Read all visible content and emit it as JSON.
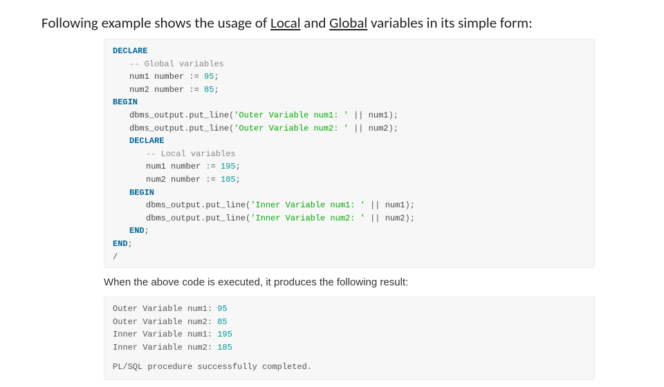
{
  "title_pre": "Following example shows the usage of ",
  "title_local": "Local",
  "title_and": " and ",
  "title_global": "Global",
  "title_post": " variables in its simple form:",
  "code": {
    "l01_declare": "DECLARE",
    "l02a": "-- ",
    "l02b": "Global",
    "l02c": " variables",
    "l03a": "num1 number ",
    "l03b": ":=",
    "l03c": " ",
    "l03d": "95",
    "l03e": ";",
    "l04a": "num2 number ",
    "l04b": ":=",
    "l04c": " ",
    "l04d": "85",
    "l04e": ";",
    "l05_begin": "BEGIN",
    "l06a": "dbms_output",
    "l06b": ".",
    "l06c": "put_line",
    "l06d": "(",
    "l06e": "'Outer Variable num1: '",
    "l06f": " || ",
    "l06g": "num1",
    "l06h": ");",
    "l07a": "dbms_output",
    "l07b": ".",
    "l07c": "put_line",
    "l07d": "(",
    "l07e": "'Outer Variable num2: '",
    "l07f": " || ",
    "l07g": "num2",
    "l07h": ");",
    "l08_declare": "DECLARE",
    "l09a": "-- ",
    "l09b": "Local",
    "l09c": " variables",
    "l10a": "num1 number ",
    "l10b": ":=",
    "l10c": " ",
    "l10d": "195",
    "l10e": ";",
    "l11a": "num2 number ",
    "l11b": ":=",
    "l11c": " ",
    "l11d": "185",
    "l11e": ";",
    "l12_begin": "BEGIN",
    "l13a": "dbms_output",
    "l13b": ".",
    "l13c": "put_line",
    "l13d": "(",
    "l13e": "'Inner Variable num1: '",
    "l13f": " || ",
    "l13g": "num1",
    "l13h": ");",
    "l14a": "dbms_output",
    "l14b": ".",
    "l14c": "put_line",
    "l14d": "(",
    "l14e": "'Inner Variable num2: '",
    "l14f": " || ",
    "l14g": "num2",
    "l14h": ");",
    "l15_end": "END",
    "l15_s": ";",
    "l16_end": "END",
    "l16_s": ";",
    "l17_slash": "/"
  },
  "intertext": "When the above code is executed, it produces the following result:",
  "out": {
    "r1a": "Outer Variable num1: ",
    "r1b": "95",
    "r2a": "Outer Variable num2: ",
    "r2b": "85",
    "r3a": "Inner Variable num1: ",
    "r3b": "195",
    "r4a": "Inner Variable num2: ",
    "r4b": "185",
    "success": "PL/SQL procedure successfully completed."
  }
}
